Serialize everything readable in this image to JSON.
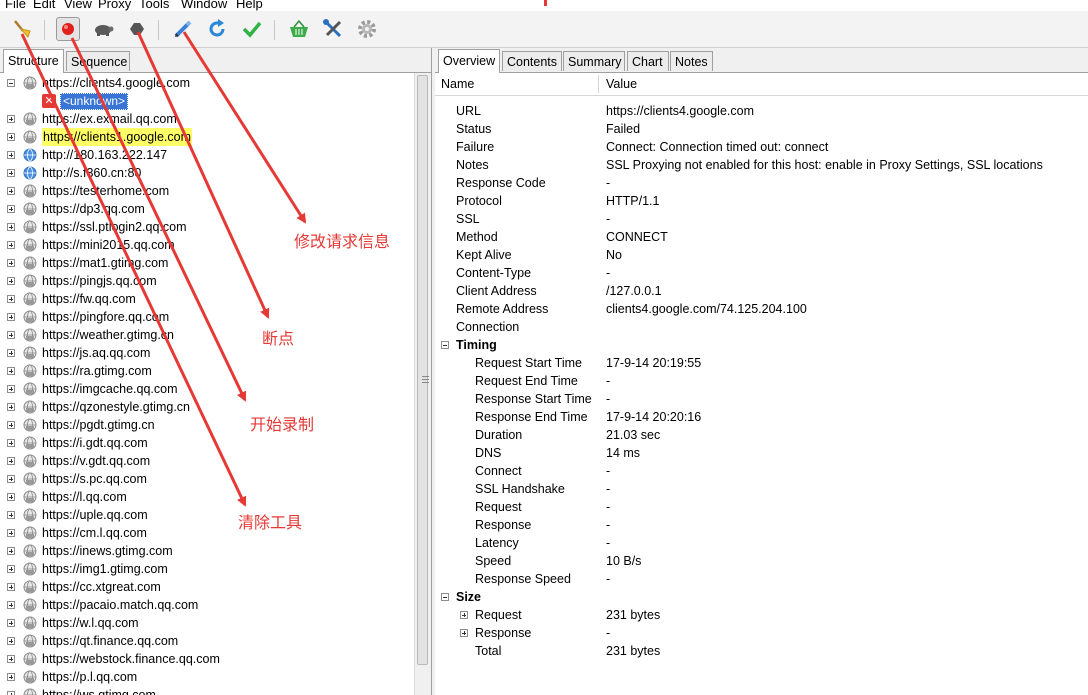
{
  "menu": [
    "File",
    "Edit",
    "View",
    "Proxy",
    "Tools",
    "Window",
    "Help"
  ],
  "toolbar": [
    {
      "icon": "broom-icon"
    },
    {
      "icon": "record-icon"
    },
    {
      "icon": "throttle-turtle-icon"
    },
    {
      "icon": "breakpoint-hexagon-icon"
    },
    {
      "icon": "pen-icon"
    },
    {
      "icon": "refresh-icon"
    },
    {
      "icon": "checkmark-icon"
    },
    {
      "icon": "basket-icon"
    },
    {
      "icon": "tools-icon"
    },
    {
      "icon": "settings-gear-icon"
    }
  ],
  "left_tabs": [
    "Structure",
    "Sequence"
  ],
  "tree": {
    "root": "https://clients4.google.com",
    "child": "<unknown>",
    "items": [
      "https://ex.exmail.qq.com",
      "https://clients1.google.com",
      "http://180.163.222.147",
      "http://s.f360.cn:80",
      "https://testerhome.com",
      "https://dp3.qq.com",
      "https://ssl.ptlogin2.qq.com",
      "https://mini2015.qq.com",
      "https://mat1.gtimg.com",
      "https://pingjs.qq.com",
      "https://fw.qq.com",
      "https://pingfore.qq.com",
      "https://weather.gtimg.cn",
      "https://js.aq.qq.com",
      "https://ra.gtimg.com",
      "https://imgcache.qq.com",
      "https://qzonestyle.gtimg.cn",
      "https://pgdt.gtimg.cn",
      "https://i.gdt.qq.com",
      "https://v.gdt.qq.com",
      "https://s.pc.qq.com",
      "https://l.qq.com",
      "https://uple.qq.com",
      "https://cm.l.qq.com",
      "https://inews.gtimg.com",
      "https://img1.gtimg.com",
      "https://cc.xtgreat.com",
      "https://pacaio.match.qq.com",
      "https://w.l.qq.com",
      "https://qt.finance.qq.com",
      "https://webstock.finance.qq.com",
      "https://p.l.qq.com",
      "https://ws.gtimg.com"
    ]
  },
  "right_tabs": [
    "Overview",
    "Contents",
    "Summary",
    "Chart",
    "Notes"
  ],
  "columns": {
    "name": "Name",
    "value": "Value"
  },
  "overview": [
    {
      "name": "URL",
      "value": "https://clients4.google.com"
    },
    {
      "name": "Status",
      "value": "Failed"
    },
    {
      "name": "Failure",
      "value": "Connect: Connection timed out: connect"
    },
    {
      "name": "Notes",
      "value": "SSL Proxying not enabled for this host: enable in Proxy Settings, SSL locations"
    },
    {
      "name": "Response Code",
      "value": "-"
    },
    {
      "name": "Protocol",
      "value": "HTTP/1.1"
    },
    {
      "name": "SSL",
      "value": "-"
    },
    {
      "name": "Method",
      "value": "CONNECT"
    },
    {
      "name": "Kept Alive",
      "value": "No"
    },
    {
      "name": "Content-Type",
      "value": "-"
    },
    {
      "name": "Client Address",
      "value": "/127.0.0.1"
    },
    {
      "name": "Remote Address",
      "value": "clients4.google.com/74.125.204.100"
    },
    {
      "name": "Connection",
      "value": ""
    }
  ],
  "timing": {
    "title": "Timing",
    "rows": [
      {
        "name": "Request Start Time",
        "value": "17-9-14 20:19:55"
      },
      {
        "name": "Request End Time",
        "value": "-"
      },
      {
        "name": "Response Start Time",
        "value": "-"
      },
      {
        "name": "Response End Time",
        "value": "17-9-14 20:20:16"
      },
      {
        "name": "Duration",
        "value": "21.03 sec"
      },
      {
        "name": "DNS",
        "value": "14 ms"
      },
      {
        "name": "Connect",
        "value": "-"
      },
      {
        "name": "SSL Handshake",
        "value": "-"
      },
      {
        "name": "Request",
        "value": "-"
      },
      {
        "name": "Response",
        "value": "-"
      },
      {
        "name": "Latency",
        "value": "-"
      },
      {
        "name": "Speed",
        "value": "10 B/s"
      },
      {
        "name": "Response Speed",
        "value": "-"
      }
    ]
  },
  "size": {
    "title": "Size",
    "rows": [
      {
        "name": "Request",
        "value": "231 bytes",
        "expandable": true
      },
      {
        "name": "Response",
        "value": "-",
        "expandable": true
      },
      {
        "name": "Total",
        "value": "231 bytes",
        "expandable": false
      }
    ]
  },
  "annotations": {
    "modify": "修改请求信息",
    "breakpoint": "断点",
    "record": "开始录制",
    "clear": "清除工具"
  },
  "colors": {
    "annotation": "#e53935",
    "highlight": "#ffff66",
    "selection": "#3875d7"
  }
}
